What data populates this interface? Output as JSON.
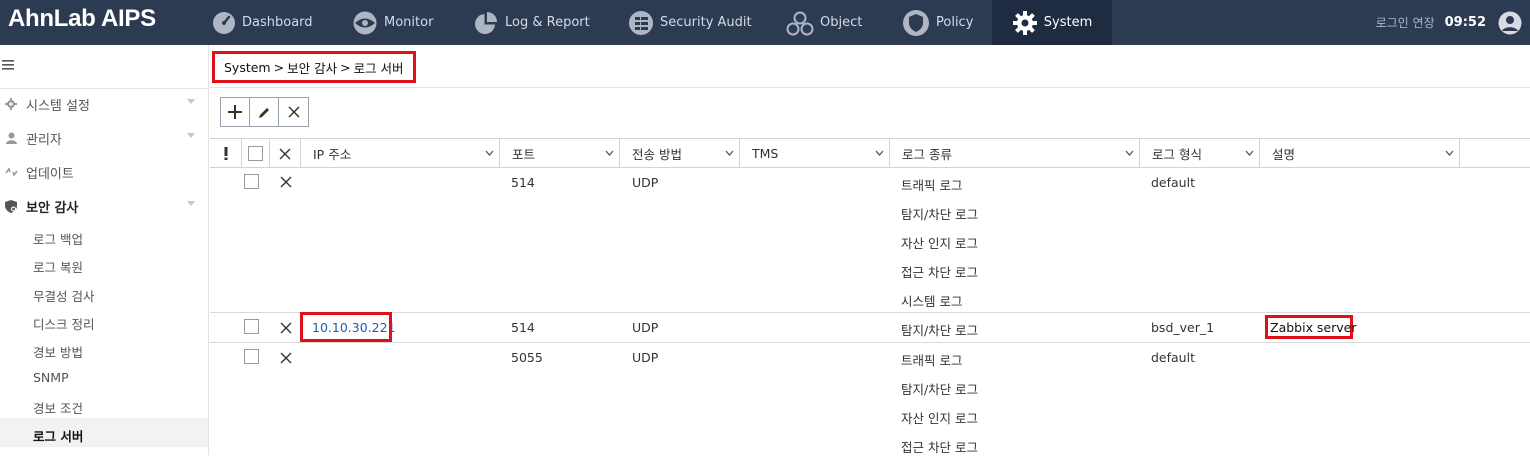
{
  "app": {
    "logo": "AhnLab AIPS"
  },
  "nav": {
    "items": [
      {
        "label": "Dashboard",
        "icon": "gauge-icon"
      },
      {
        "label": "Monitor",
        "icon": "eye-icon"
      },
      {
        "label": "Log & Report",
        "icon": "pie-chart-icon"
      },
      {
        "label": "Security Audit",
        "icon": "audit-list-icon"
      },
      {
        "label": "Object",
        "icon": "object-circles-icon"
      },
      {
        "label": "Policy",
        "icon": "shield-icon"
      },
      {
        "label": "System",
        "icon": "gear-icon",
        "active": true
      }
    ],
    "extend_login": "로그인 연장",
    "clock": "09:52"
  },
  "sidebar": {
    "groups": [
      {
        "label": "시스템 설정",
        "icon": "gear-icon"
      },
      {
        "label": "관리자",
        "icon": "person-icon"
      },
      {
        "label": "업데이트",
        "icon": "update-arrows-icon"
      },
      {
        "label": "보안 감사",
        "icon": "security-shield-icon",
        "expanded": true
      }
    ],
    "sub_items": [
      "로그 백업",
      "로그 복원",
      "무결성 검사",
      "디스크 정리",
      "경보 방법",
      "SNMP",
      "경보 조건",
      "로그 서버"
    ],
    "active_sub": "로그 서버"
  },
  "breadcrumb": {
    "items": [
      "System",
      "보안 감사",
      "로그 서버"
    ],
    "separator": ">"
  },
  "table": {
    "columns": [
      "IP 주소",
      "포트",
      "전송 방법",
      "TMS",
      "로그 종류",
      "로그 형식",
      "설명"
    ],
    "rows": [
      {
        "ip": "",
        "port": "514",
        "method": "UDP",
        "tms": "",
        "log_types": [
          "트래픽 로그",
          "탐지/차단 로그",
          "자산 인지 로그",
          "접근 차단 로그",
          "시스템 로그"
        ],
        "format": "default",
        "description": ""
      },
      {
        "ip": "10.10.30.221",
        "port": "514",
        "method": "UDP",
        "tms": "",
        "log_types": [
          "탐지/차단 로그"
        ],
        "format": "bsd_ver_1",
        "description": "Zabbix server"
      },
      {
        "ip": "",
        "port": "5055",
        "method": "UDP",
        "tms": "",
        "log_types": [
          "트래픽 로그",
          "탐지/차단 로그",
          "자산 인지 로그",
          "접근 차단 로그"
        ],
        "format": "default",
        "description": ""
      }
    ]
  },
  "colors": {
    "topbar": "#2c3a52",
    "active_nav": "#1f2b40",
    "highlight": "#e0101a",
    "link": "#1a5fb4"
  }
}
